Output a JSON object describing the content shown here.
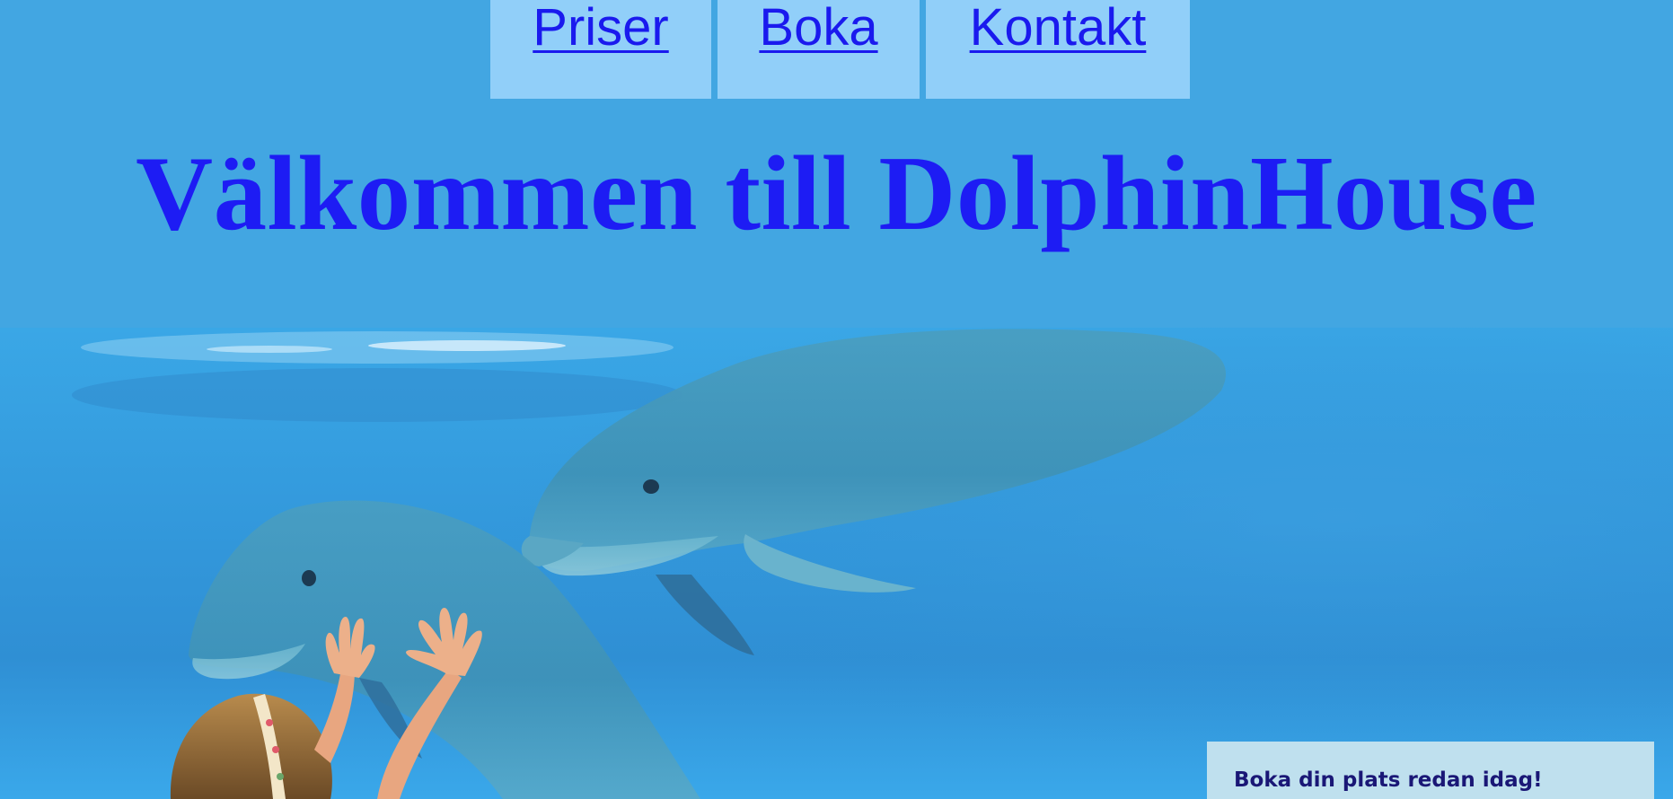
{
  "nav": {
    "items": [
      {
        "label": "Priser"
      },
      {
        "label": "Boka"
      },
      {
        "label": "Kontakt"
      }
    ]
  },
  "header": {
    "title": "Välkommen till DolphinHouse"
  },
  "hero": {
    "image": "dolphins-and-child-photo"
  },
  "booking": {
    "text": "Boka din plats redan idag!"
  },
  "colors": {
    "background": "#42a6e2",
    "nav_bg": "#91cff9",
    "link": "#1a1aee",
    "title": "#1d1cf4",
    "booking_bg": "#bfe0ee",
    "booking_text": "#1a1776"
  }
}
